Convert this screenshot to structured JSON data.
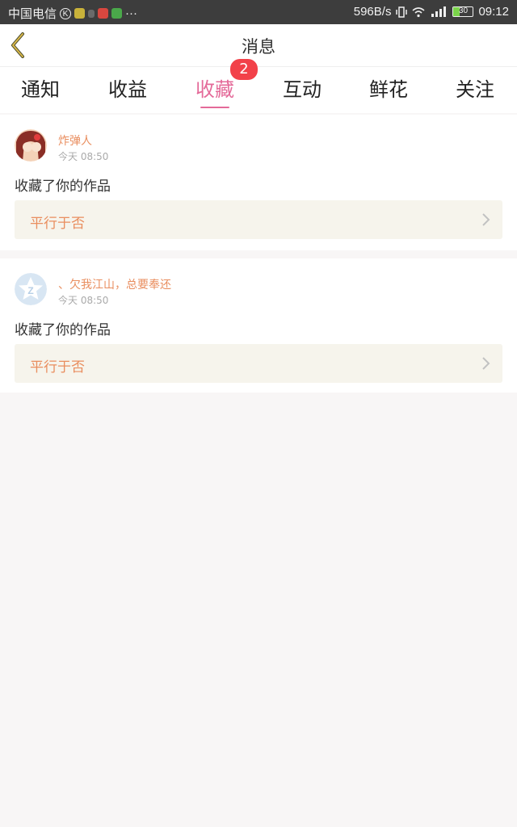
{
  "status_bar": {
    "carrier": "中国电信",
    "k_badge": "K",
    "network_speed": "596B/s",
    "battery_level": "30",
    "time": "09:12",
    "more": "···"
  },
  "header": {
    "title": "消息"
  },
  "tabs": {
    "items": [
      {
        "label": "通知"
      },
      {
        "label": "收益"
      },
      {
        "label": "收藏"
      },
      {
        "label": "互动"
      },
      {
        "label": "鲜花"
      },
      {
        "label": "关注"
      }
    ],
    "active_index": 2,
    "badge": "2"
  },
  "notifications": [
    {
      "username": "炸弹人",
      "time": "今天 08:50",
      "action": "收藏了你的作品",
      "work_title": "平行于否"
    },
    {
      "username": "、欠我江山，总要奉还",
      "time": "今天 08:50",
      "action": "收藏了你的作品",
      "work_title": "平行于否"
    }
  ],
  "colors": {
    "accent": "#e46a99",
    "name_orange": "#e98e5f",
    "badge_red": "#f24149",
    "work_bg": "#f6f4ec",
    "page_bg": "#f8f6f6"
  }
}
